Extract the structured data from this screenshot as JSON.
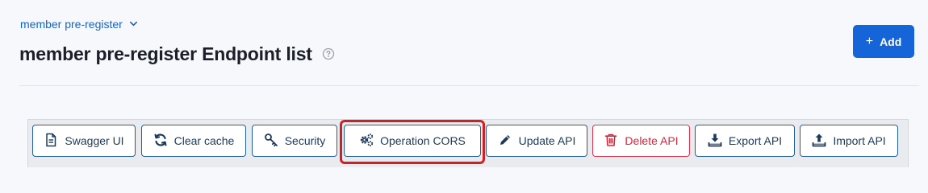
{
  "breadcrumb": {
    "label": "member pre-register"
  },
  "header": {
    "title": "member pre-register Endpoint list"
  },
  "actions": {
    "add_label": "Add"
  },
  "toolbar": {
    "swagger_label": "Swagger UI",
    "clear_cache_label": "Clear cache",
    "security_label": "Security",
    "operation_cors_label": "Operation CORS",
    "update_api_label": "Update API",
    "delete_api_label": "Delete API",
    "export_api_label": "Export API",
    "import_api_label": "Import API"
  },
  "colors": {
    "primary": "#1565d8",
    "link": "#1565c0",
    "button_border": "#1f5f9e",
    "danger": "#d7263d",
    "highlight": "#d31f1f"
  }
}
